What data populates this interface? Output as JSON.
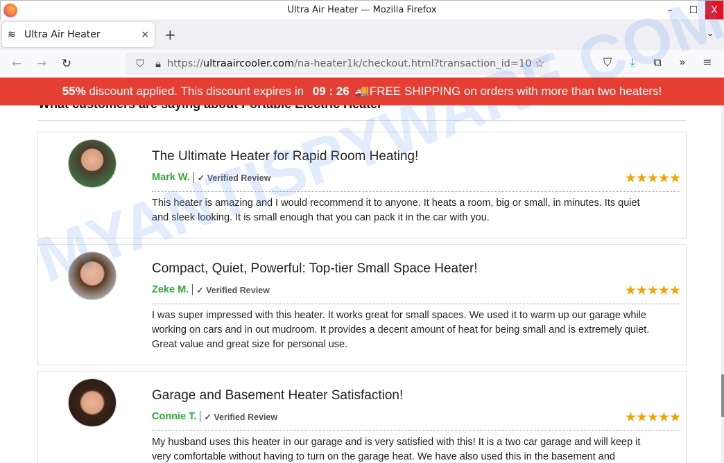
{
  "window": {
    "title": "Ultra Air Heater — Mozilla Firefox",
    "controls": [
      "–",
      "☐",
      "X"
    ]
  },
  "tab": {
    "title": "Ultra Air Heater",
    "close": "×",
    "new": "+",
    "list": "⌄"
  },
  "nav": {
    "back": "←",
    "forward": "→",
    "reload": "↻",
    "url_prefix": "https://",
    "url_domain": "ultraaircooler.com",
    "url_path": "/na-heater1k/checkout.html?transaction_id=10"
  },
  "banner": {
    "percent": "55%",
    "text1": " discount applied. This discount expires in ",
    "timer": "09 : 26",
    "icon": "🚚",
    "text2": "FREE SHIPPING on orders with more than two heaters!",
    "color": "#e53e33"
  },
  "section_heading": "What customers are saying about Portable Electric Heater",
  "reviews": [
    {
      "title": "The Ultimate Heater for Rapid Room Heating!",
      "name": "Mark W.",
      "verified": "✓ Verified Review",
      "stars": "★★★★★",
      "rating": 5,
      "text": "This heater is amazing and I would recommend it to anyone. It heats a room, big or small, in minutes. Its quiet and sleek looking. It is small enough that you can pack it in the car with you."
    },
    {
      "title": "Compact, Quiet, Powerful: Top-tier Small Space Heater!",
      "name": "Zeke M.",
      "verified": "✓ Verified Review",
      "stars": "★★★★★",
      "rating": 5,
      "text": "I was super impressed with this heater. It works great for small spaces. We used it to warm up our garage while working on cars and in out mudroom. It provides a decent amount of heat for being small and is extremely quiet. Great value and great size for personal use."
    },
    {
      "title": "Garage and Basement Heater Satisfaction!",
      "name": "Connie T.",
      "verified": "✓ Verified Review",
      "stars": "★★★★★",
      "rating": 5,
      "text": "My husband uses this heater in our garage and is very satisfied with this! It is a two car garage and will keep it very comfortable without having to turn on the garage heat. We have also used this in the basement and"
    }
  ],
  "watermark": "MYANTISPYWARE.COM"
}
